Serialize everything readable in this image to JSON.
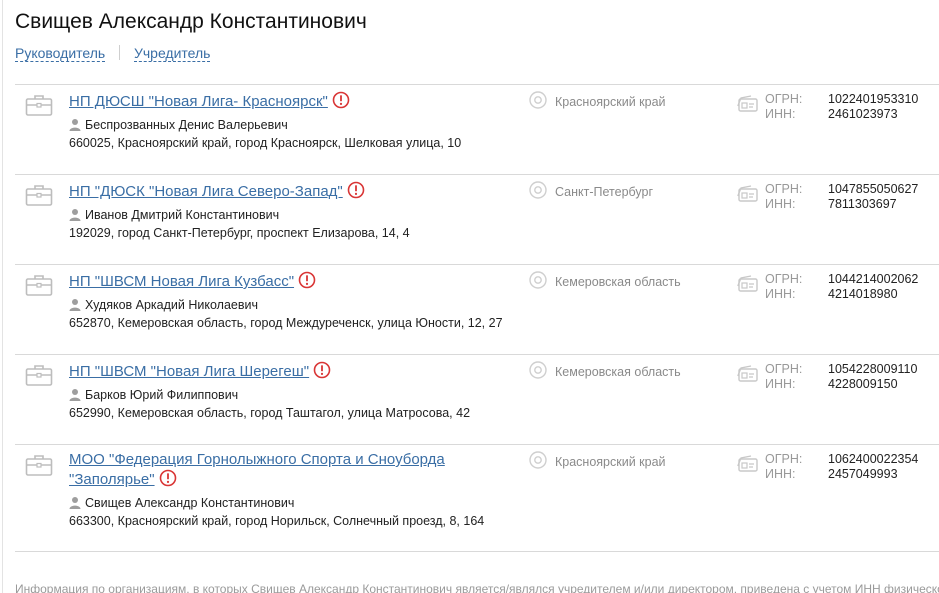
{
  "person_name": "Свищев Александр Константинович",
  "roles": {
    "director_label": "Руководитель",
    "founder_label": "Учредитель"
  },
  "labels": {
    "ogrn": "ОГРН:",
    "inn": "ИНН:"
  },
  "organizations": [
    {
      "name": "НП ДЮСШ \"Новая Лига- Красноярск\"",
      "name_lines": [
        "НП ДЮСШ \"Новая Лига- Красноярск\""
      ],
      "head": "Беспрозванных Денис Валерьевич",
      "address": "660025, Красноярский край, город Красноярск, Шелковая улица, 10",
      "region": "Красноярский край",
      "ogrn": "1022401953310",
      "inn": "2461023973"
    },
    {
      "name": "НП \"ДЮСК \"Новая Лига Северо-Запад\"",
      "name_lines": [
        "НП \"ДЮСК \"Новая Лига Северо-Запад\""
      ],
      "head": "Иванов Дмитрий Константинович",
      "address": "192029, город Санкт-Петербург, проспект Елизарова, 14, 4",
      "region": "Санкт-Петербург",
      "ogrn": "1047855050627",
      "inn": "7811303697"
    },
    {
      "name": "НП \"ШВСМ Новая Лига Кузбасс\"",
      "name_lines": [
        "НП \"ШВСМ Новая Лига Кузбасс\""
      ],
      "head": "Худяков Аркадий Николаевич",
      "address": "652870, Кемеровская область, город Междуреченск, улица Юности, 12, 27",
      "region": "Кемеровская область",
      "ogrn": "1044214002062",
      "inn": "4214018980"
    },
    {
      "name": "НП \"ШВСМ \"Новая Лига Шерегеш\"",
      "name_lines": [
        "НП \"ШВСМ \"Новая Лига Шерегеш\""
      ],
      "head": "Барков Юрий Филиппович",
      "address": "652990, Кемеровская область, город Таштагол, улица Матросова, 42",
      "region": "Кемеровская область",
      "ogrn": "1054228009110",
      "inn": "4228009150"
    },
    {
      "name": "МОО \"Федерация Горнолыжного Спорта и Сноуборда \"Заполярье\"",
      "name_lines": [
        "МОО \"Федерация Горнолыжного Спорта и Сноуборда",
        "\"Заполярье\""
      ],
      "head": "Свищев Александр Константинович",
      "address": "663300, Красноярский край, город Норильск, Солнечный проезд, 8, 164",
      "region": "Красноярский край",
      "ogrn": "1062400022354",
      "inn": "2457049993"
    }
  ],
  "footer_text": "Информация по организациям, в которых Свищев Александр Константинович является/являлся учредителем и/или директором, приведена с учетом ИНН физического",
  "icons": {
    "organization": "briefcase-icon",
    "warning": "warning-icon",
    "person": "person-icon",
    "region": "location-pin-icon",
    "registration": "id-card-icon"
  },
  "colors": {
    "link": "#3a6ea5",
    "warning": "#d93535",
    "muted": "#8a8a8a",
    "divider": "#d9d9d9"
  }
}
